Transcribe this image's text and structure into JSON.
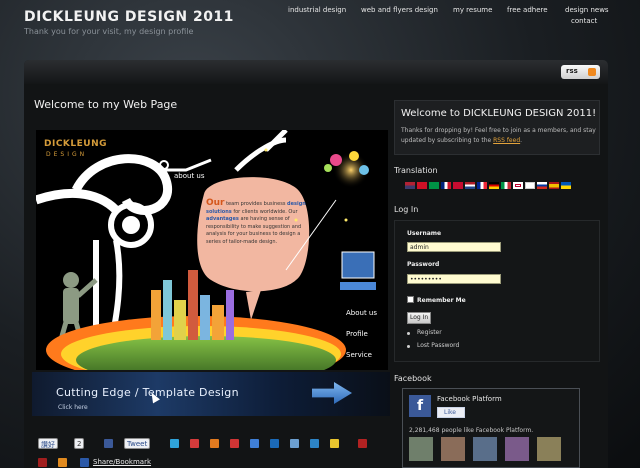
{
  "header": {
    "site_title": "DICKLEUNG DESIGN 2011",
    "tagline": "Thank you for your visit, my design profile"
  },
  "nav": [
    {
      "label": "industrial design"
    },
    {
      "label": "web and flyers design"
    },
    {
      "label": "my resume"
    },
    {
      "label": "free adhere"
    },
    {
      "label": "design news"
    },
    {
      "label": "contact"
    }
  ],
  "rss_label": "rss",
  "main": {
    "heading": "Welcome to my Web Page",
    "banner": {
      "brand_line1": "DICKLEUNG",
      "brand_line2": "DESIGN",
      "about_us": "about us",
      "bubble_title": "Our",
      "bubble_text_1": "team provides",
      "bubble_text_2": "business",
      "bubble_highlight_1": "design solutions",
      "bubble_text_3": "for clients worldwide. Our",
      "bubble_highlight_2": "advantages",
      "bubble_text_4": "are having sense of responsibility to make suggestion and analysis for your business to design a series of tailor-made design.",
      "menu_about": "About us",
      "menu_profile": "Profile",
      "menu_service": "Service"
    },
    "cutting_edge": {
      "title": "Cutting Edge / Template Design",
      "subtitle": "Click here"
    },
    "share": {
      "like_label": "讚好",
      "like_count": "2",
      "tweet_label": "Tweet",
      "bookmark_label": "Share/Bookmark"
    }
  },
  "sidebar": {
    "welcome_title": "Welcome to DICKLEUNG DESIGN 2011!",
    "welcome_text": "Thanks for dropping by! Feel free to join as a members, and stay updated by subscribing to the",
    "welcome_link": "RSS feed",
    "welcome_end": ".",
    "translation_heading": "Translation",
    "login_heading": "Log In",
    "username_label": "Username",
    "username_value": "admin",
    "password_label": "Password",
    "password_value": "•••••••••",
    "remember_label": "Remember Me",
    "login_button": "Log In",
    "register_link": "Register",
    "lost_password_link": "Lost Password",
    "facebook_heading": "Facebook",
    "fb_page_name": "Facebook Platform",
    "fb_like_button": "Like",
    "fb_like_count_text": "2,281,468 people like Facebook Platform."
  },
  "colors": {
    "accent_orange": "#e3a33b",
    "link_blue": "#3b5998",
    "banner_green": "#6ea33a"
  }
}
